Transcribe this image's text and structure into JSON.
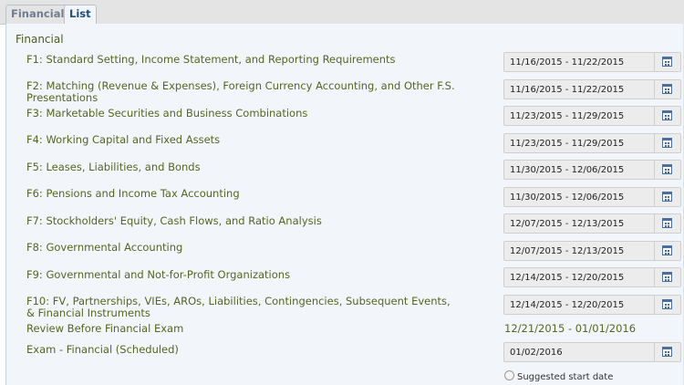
{
  "tabs": [
    {
      "label": "Financial",
      "active": false
    },
    {
      "label": "List",
      "active": true
    }
  ],
  "section": {
    "title": "Financial"
  },
  "items": [
    {
      "label": "F1: Standard Setting, Income Statement, and Reporting Requirements",
      "dates": "11/16/2015 - 11/22/2015"
    },
    {
      "label": "F2: Matching (Revenue & Expenses), Foreign Currency Accounting, and Other F.S. Presentations",
      "dates": "11/16/2015 - 11/22/2015"
    },
    {
      "label": "F3: Marketable Securities and Business Combinations",
      "dates": "11/23/2015 - 11/29/2015"
    },
    {
      "label": "F4: Working Capital and Fixed Assets",
      "dates": "11/23/2015 - 11/29/2015"
    },
    {
      "label": "F5: Leases, Liabilities, and Bonds",
      "dates": "11/30/2015 - 12/06/2015"
    },
    {
      "label": "F6: Pensions and Income Tax Accounting",
      "dates": "11/30/2015 - 12/06/2015"
    },
    {
      "label": "F7: Stockholders' Equity, Cash Flows, and Ratio Analysis",
      "dates": "12/07/2015 - 12/13/2015"
    },
    {
      "label": "F8: Governmental Accounting",
      "dates": "12/07/2015 - 12/13/2015"
    },
    {
      "label": "F9: Governmental and Not-for-Profit Organizations",
      "dates": "12/14/2015 - 12/20/2015"
    },
    {
      "label": "F10: FV, Partnerships, VIEs, AROs, Liabilities, Contingencies, Subsequent Events, & Financial Instruments",
      "dates": "12/14/2015 - 12/20/2015"
    }
  ],
  "review": {
    "label": "Review Before Financial Exam",
    "dates": "12/21/2015 - 01/01/2016"
  },
  "exam": {
    "label": "Exam - Financial (Scheduled)",
    "date": "01/02/2016"
  },
  "suggested_start": {
    "label": "Suggested start date",
    "checked": false
  },
  "icons": {
    "calendar": "calendar-icon",
    "radio": "radio-icon"
  },
  "colors": {
    "label_text": "#57651f",
    "panel_bg": "#f2f6fb",
    "tab_active": "#1f4e79",
    "calendar_icon": "#4a6f9c"
  }
}
